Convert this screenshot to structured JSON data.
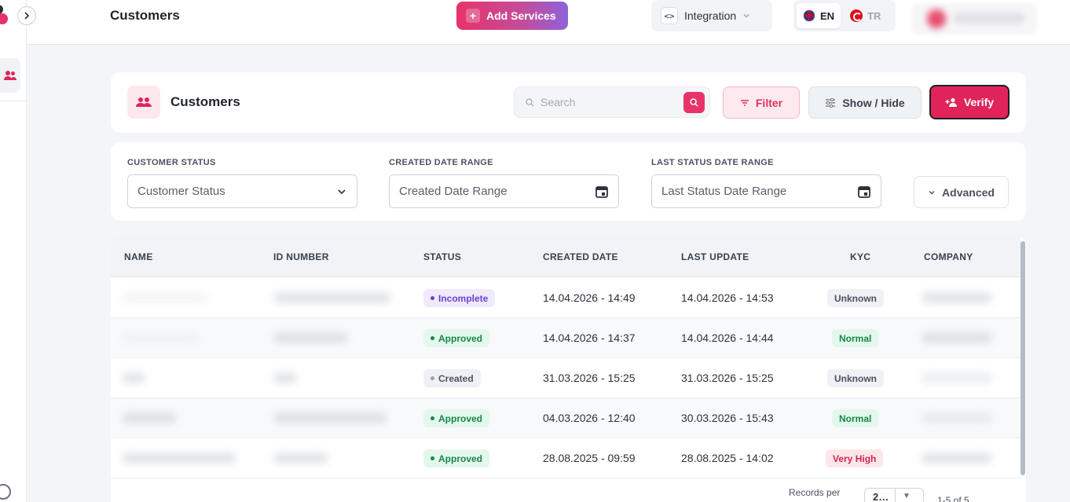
{
  "topbar": {
    "page_title": "Customers",
    "add_services_label": "Add Services",
    "integration_label": "Integration",
    "lang_en": "EN",
    "lang_tr": "TR"
  },
  "header": {
    "title": "Customers",
    "search_placeholder": "Search",
    "filter_label": "Filter",
    "show_hide_label": "Show / Hide",
    "verify_label": "Verify"
  },
  "filters": {
    "customer_status_label": "CUSTOMER STATUS",
    "customer_status_placeholder": "Customer Status",
    "created_date_label": "CREATED DATE RANGE",
    "created_date_placeholder": "Created Date Range",
    "last_status_label": "LAST STATUS DATE RANGE",
    "last_status_placeholder": "Last Status Date Range",
    "advanced_label": "Advanced"
  },
  "table": {
    "columns": [
      "NAME",
      "ID NUMBER",
      "STATUS",
      "CREATED DATE",
      "LAST UPDATE",
      "KYC",
      "COMPANY"
    ],
    "rows": [
      {
        "status": "Incomplete",
        "created": "14.04.2026 - 14:49",
        "updated": "14.04.2026 - 14:53",
        "kyc": "Unknown"
      },
      {
        "status": "Approved",
        "created": "14.04.2026 - 14:37",
        "updated": "14.04.2026 - 14:44",
        "kyc": "Normal"
      },
      {
        "status": "Created",
        "created": "31.03.2026 - 15:25",
        "updated": "31.03.2026 - 15:25",
        "kyc": "Unknown"
      },
      {
        "status": "Approved",
        "created": "04.03.2026 - 12:40",
        "updated": "30.03.2026 - 15:43",
        "kyc": "Normal"
      },
      {
        "status": "Approved",
        "created": "28.08.2025 - 09:59",
        "updated": "28.08.2025 - 14:02",
        "kyc": "Very High"
      }
    ]
  },
  "pager": {
    "records_per_label": "Records per",
    "per_page_value": "2…",
    "range_text": "1-5 of 5"
  },
  "colors": {
    "accent": "#e0245a",
    "status_approved": "#17874a",
    "status_incomplete": "#6d3fd0",
    "kyc_very_high": "#d1254f"
  }
}
